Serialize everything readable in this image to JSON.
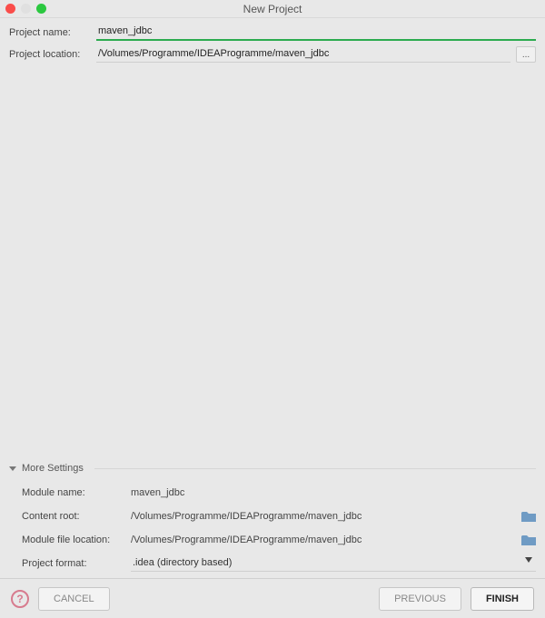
{
  "window": {
    "title": "New Project"
  },
  "form": {
    "projectName": {
      "label": "Project name:",
      "value": "maven_jdbc"
    },
    "projectLocation": {
      "label": "Project location:",
      "value": "/Volumes/Programme/IDEAProgramme/maven_jdbc",
      "browse": "..."
    }
  },
  "moreSettings": {
    "header": "More Settings",
    "moduleName": {
      "label": "Module name:",
      "value": "maven_jdbc"
    },
    "contentRoot": {
      "label": "Content root:",
      "value": "/Volumes/Programme/IDEAProgramme/maven_jdbc"
    },
    "moduleFile": {
      "label": "Module file location:",
      "value": "/Volumes/Programme/IDEAProgramme/maven_jdbc"
    },
    "projectFormat": {
      "label": "Project format:",
      "value": ".idea (directory based)"
    }
  },
  "footer": {
    "cancel": "CANCEL",
    "previous": "PREVIOUS",
    "finish": "FINISH"
  }
}
